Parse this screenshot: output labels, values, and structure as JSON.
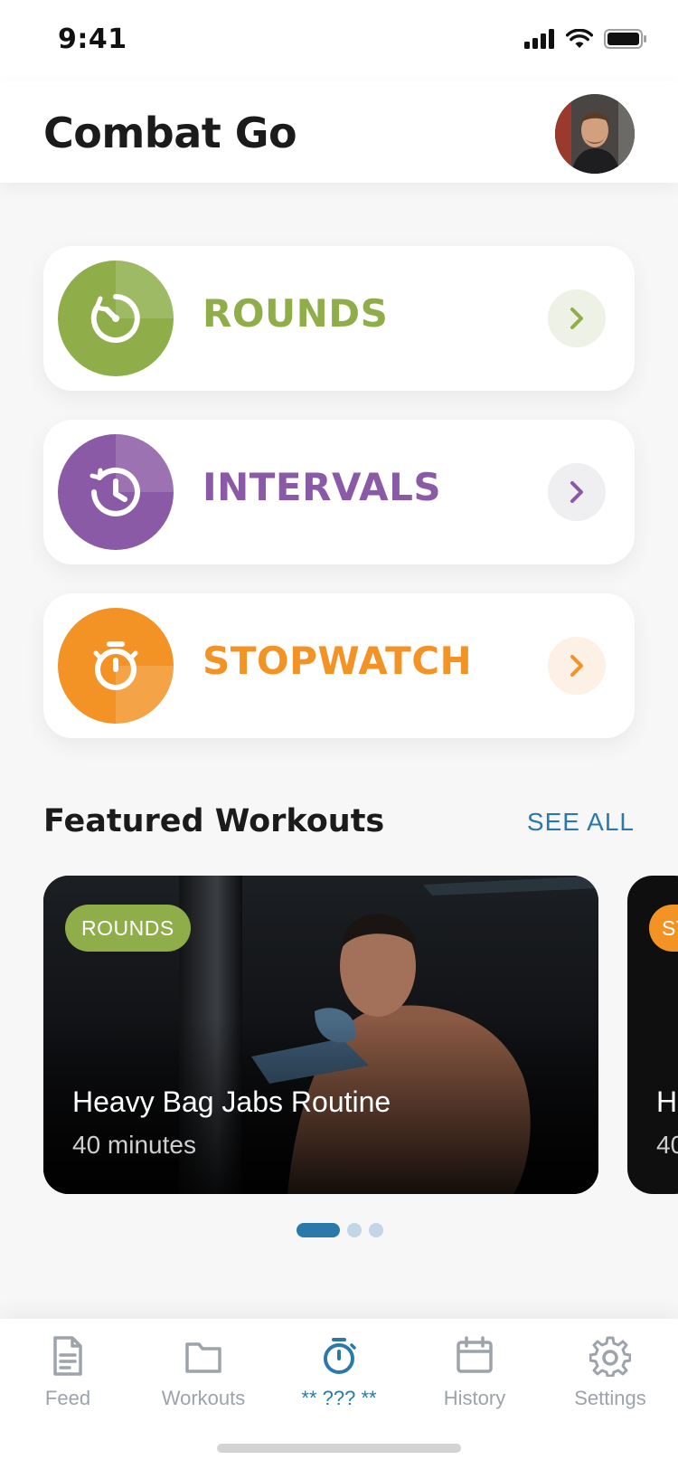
{
  "status_bar": {
    "time": "9:41"
  },
  "header": {
    "title": "Combat Go"
  },
  "timer_cards": [
    {
      "label": "ROUNDS",
      "color": "#8fae4a",
      "icon": "stopwatch-refresh-icon"
    },
    {
      "label": "INTERVALS",
      "color": "#8b5aa6",
      "icon": "clock-rewind-icon"
    },
    {
      "label": "STOPWATCH",
      "color": "#f39326",
      "icon": "stopwatch-icon"
    }
  ],
  "featured": {
    "title": "Featured Workouts",
    "see_all": "SEE ALL",
    "cards": [
      {
        "badge": "ROUNDS",
        "name": "Heavy Bag Jabs Routine",
        "duration": "40 minutes",
        "badge_color": "#8fae4a"
      },
      {
        "badge": "ST",
        "name": "H",
        "duration": "40",
        "badge_color": "#f39326"
      }
    ],
    "pages": 3,
    "active_page": 1
  },
  "tabbar": {
    "items": [
      {
        "label": "Feed",
        "icon": "document-icon",
        "active": false
      },
      {
        "label": "Workouts",
        "icon": "folder-icon",
        "active": false
      },
      {
        "label": "** ??? **",
        "icon": "stopwatch-icon",
        "active": true
      },
      {
        "label": "History",
        "icon": "calendar-icon",
        "active": false
      },
      {
        "label": "Settings",
        "icon": "gear-icon",
        "active": false
      }
    ]
  },
  "colors": {
    "accent": "#2a79aa",
    "rounds": "#8fae4a",
    "intervals": "#8b5aa6",
    "stopwatch": "#f39326"
  }
}
